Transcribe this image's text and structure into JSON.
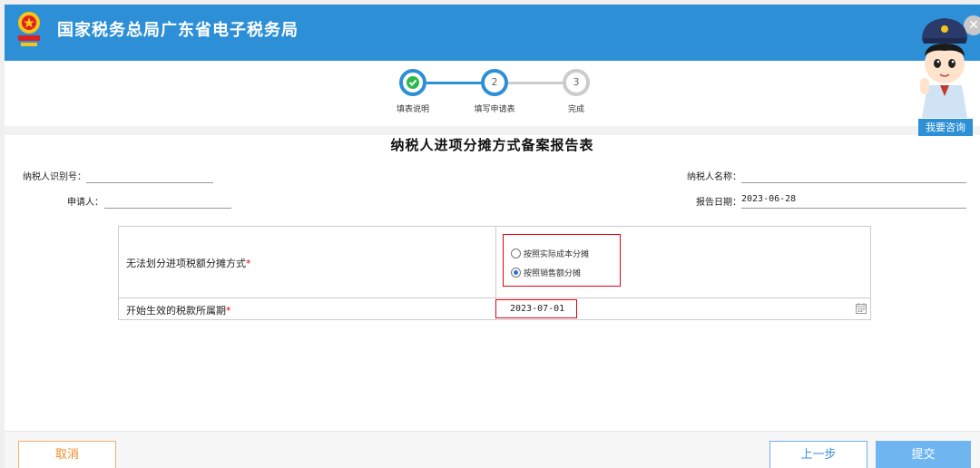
{
  "header": {
    "title": "国家税务总局广东省电子税务局",
    "close_symbol": "✕"
  },
  "assistant": {
    "consult_label": "我要咨询"
  },
  "steps": [
    {
      "label": "填表说明",
      "number": "",
      "state": "done"
    },
    {
      "label": "填写申请表",
      "number": "2",
      "state": "current"
    },
    {
      "label": "完成",
      "number": "3",
      "state": "pending"
    }
  ],
  "form": {
    "title": "纳税人进项分摊方式备案报告表",
    "taxpayer_id_label": "纳税人识别号：",
    "taxpayer_id_value": "",
    "taxpayer_name_label": "纳税人名称：",
    "taxpayer_name_value": "",
    "applicant_label": "申请人：",
    "applicant_value": "",
    "report_date_label": "报告日期：",
    "report_date_value": "2023-06-28",
    "method_label": "无法划分进项税额分摊方式",
    "required_mark": "*",
    "method_options": [
      {
        "label": "按照实际成本分摊",
        "selected": false
      },
      {
        "label": "按照销售额分摊",
        "selected": true
      }
    ],
    "period_label": "开始生效的税款所属期",
    "period_value": "2023-07-01"
  },
  "footer": {
    "cancel_label": "取消",
    "prev_label": "上一步",
    "submit_label": "提交"
  },
  "colors": {
    "brand_blue": "#2d8fd6",
    "required_red": "#e60012",
    "step_done": "#2db84d",
    "cancel_orange": "#f08a24",
    "submit_blue": "#6fb6f0"
  },
  "icons": [
    "emblem-icon",
    "close-icon",
    "check-icon",
    "calendar-icon",
    "assistant-avatar-icon"
  ]
}
